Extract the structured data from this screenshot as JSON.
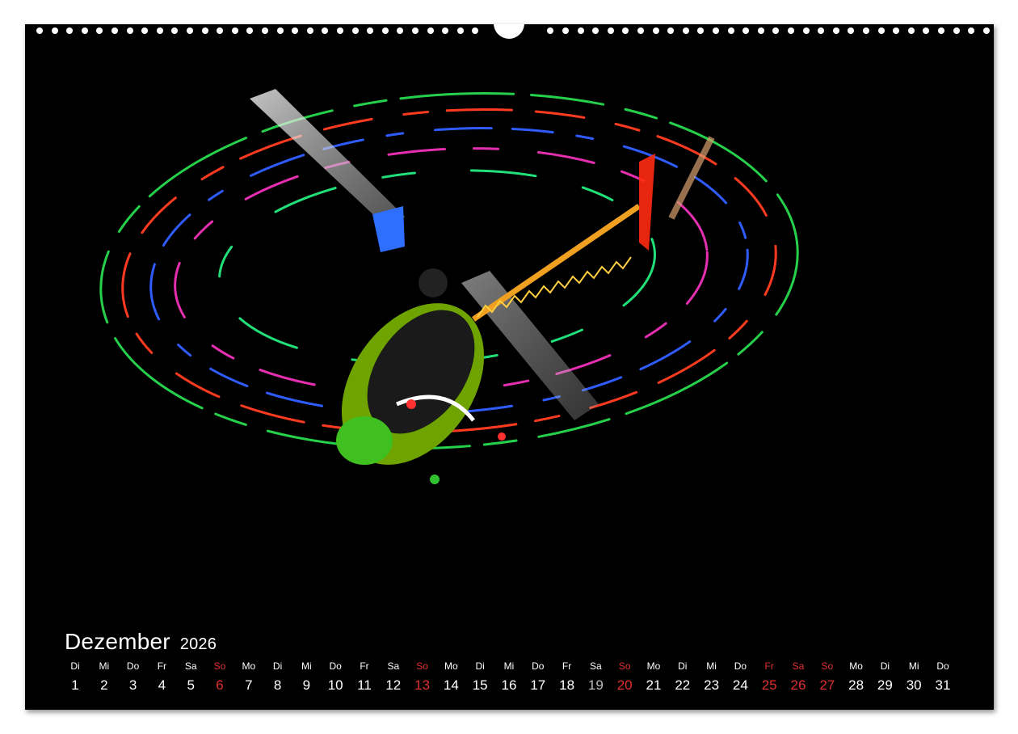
{
  "calendar": {
    "month": "Dezember",
    "year": "2026",
    "weekdays": [
      "Di",
      "Mi",
      "Do",
      "Fr",
      "Sa",
      "So",
      "Mo",
      "Di",
      "Mi",
      "Do",
      "Fr",
      "Sa",
      "So",
      "Mo",
      "Di",
      "Mi",
      "Do",
      "Fr",
      "Sa",
      "So",
      "Mo",
      "Di",
      "Mi",
      "Do",
      "Fr",
      "Sa",
      "So",
      "Mo",
      "Di",
      "Mi",
      "Do"
    ],
    "days": [
      "1",
      "2",
      "3",
      "4",
      "5",
      "6",
      "7",
      "8",
      "9",
      "10",
      "11",
      "12",
      "13",
      "14",
      "15",
      "16",
      "17",
      "18",
      "19",
      "20",
      "21",
      "22",
      "23",
      "24",
      "25",
      "26",
      "27",
      "28",
      "29",
      "30",
      "31"
    ],
    "highlight_color": "#e03030"
  },
  "photo": {
    "subject": "rc-helicopter-light-trails-icon",
    "trail_colors": [
      "#25d04a",
      "#ff3b1f",
      "#2f5cff",
      "#e52fb0",
      "#21e07a"
    ]
  }
}
